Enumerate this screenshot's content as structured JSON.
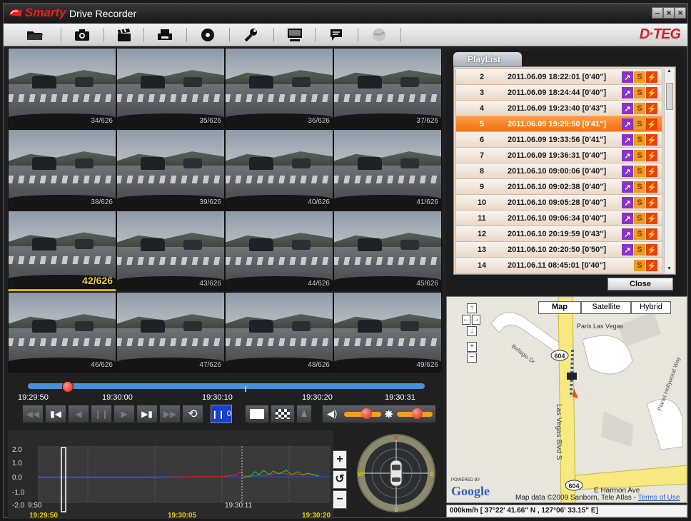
{
  "titlebar": {
    "brand": "Smarty",
    "title": "Drive Recorder",
    "buttons": [
      "minimize",
      "maximize",
      "close"
    ]
  },
  "toolbar": {
    "items": [
      "open-folder-icon",
      "camera-icon",
      "clapboard-icon",
      "print-icon",
      "disc-icon",
      "wrench-icon",
      "monitor-icon",
      "chat-icon",
      "globe-icon"
    ],
    "logo": "D·TEG"
  },
  "thumbnails": [
    {
      "caption": "34/626"
    },
    {
      "caption": "35/626"
    },
    {
      "caption": "36/626"
    },
    {
      "caption": "37/626"
    },
    {
      "caption": "38/626"
    },
    {
      "caption": "39/626"
    },
    {
      "caption": "40/626"
    },
    {
      "caption": "41/626"
    },
    {
      "caption": "42/626",
      "selected": true
    },
    {
      "caption": "43/626"
    },
    {
      "caption": "44/626"
    },
    {
      "caption": "45/626"
    },
    {
      "caption": "46/626"
    },
    {
      "caption": "47/626"
    },
    {
      "caption": "48/626"
    },
    {
      "caption": "49/626"
    }
  ],
  "timeline": {
    "labels": [
      "19:29:50",
      "19:30:00",
      "19:30:10",
      "19:30:20",
      "19:30:31"
    ],
    "position": 0.1
  },
  "controls": {
    "frame_counter": "0",
    "volume_level": 0.6,
    "brightness_level": 0.55
  },
  "graph": {
    "y_labels": [
      "2.0",
      "1.0",
      "0.0",
      "-1.0",
      "-2.0"
    ],
    "marker_label": "9:50",
    "cursor_label": "19:30:11",
    "x_labels": [
      "19:29:50",
      "19:30:05",
      "19:30:20"
    ]
  },
  "compass": {
    "n": "N",
    "e": "E",
    "s": "S",
    "w": "W"
  },
  "playlist": {
    "tab": "PlayList",
    "rows": [
      {
        "num": "2",
        "date": "2011.06.09 18:22:01 [0'40\"]",
        "gps": true
      },
      {
        "num": "3",
        "date": "2011.06.09 18:24:44 [0'40\"]",
        "gps": true
      },
      {
        "num": "4",
        "date": "2011.06.09 19:23:40 [0'43\"]",
        "gps": true
      },
      {
        "num": "5",
        "date": "2011.06.09 19:29:50 [0'41\"]",
        "gps": true,
        "active": true
      },
      {
        "num": "6",
        "date": "2011.06.09 19:33:56 [0'41\"]",
        "gps": true
      },
      {
        "num": "7",
        "date": "2011.06.09 19:36:31 [0'40\"]",
        "gps": true
      },
      {
        "num": "8",
        "date": "2011.06.10 09:00:06 [0'40\"]",
        "gps": true
      },
      {
        "num": "9",
        "date": "2011.06.10 09:02:38 [0'40\"]",
        "gps": true
      },
      {
        "num": "10",
        "date": "2011.06.10 09:05:28 [0'40\"]",
        "gps": true
      },
      {
        "num": "11",
        "date": "2011.06.10 09:06:34 [0'40\"]",
        "gps": true
      },
      {
        "num": "12",
        "date": "2011.06.10 20:19:59 [0'43\"]",
        "gps": true
      },
      {
        "num": "13",
        "date": "2011.06.10 20:20:50 [0'50\"]",
        "gps": true
      },
      {
        "num": "14",
        "date": "2011.06.11 08:45:01 [0'40\"]",
        "gps": false
      }
    ],
    "close": "Close"
  },
  "map": {
    "types": [
      "Map",
      "Satellite",
      "Hybrid"
    ],
    "labels": {
      "place": "Paris Las Vegas",
      "street1": "Bellagio Dr",
      "street2": "Las Vegas Blvd S",
      "street3": "E Harmon Ave",
      "street4": "Planet Hollywood Way",
      "route1": "604",
      "route2": "604"
    },
    "powered": "POWERED BY",
    "google": "Google",
    "data": "Map data ©2009 Sanborn, Tele Atlas - ",
    "terms": "Terms of Use"
  },
  "status": {
    "text": "000km/h  [ 37°22' 41.66\" N , 127°06' 33.15\" E]"
  }
}
